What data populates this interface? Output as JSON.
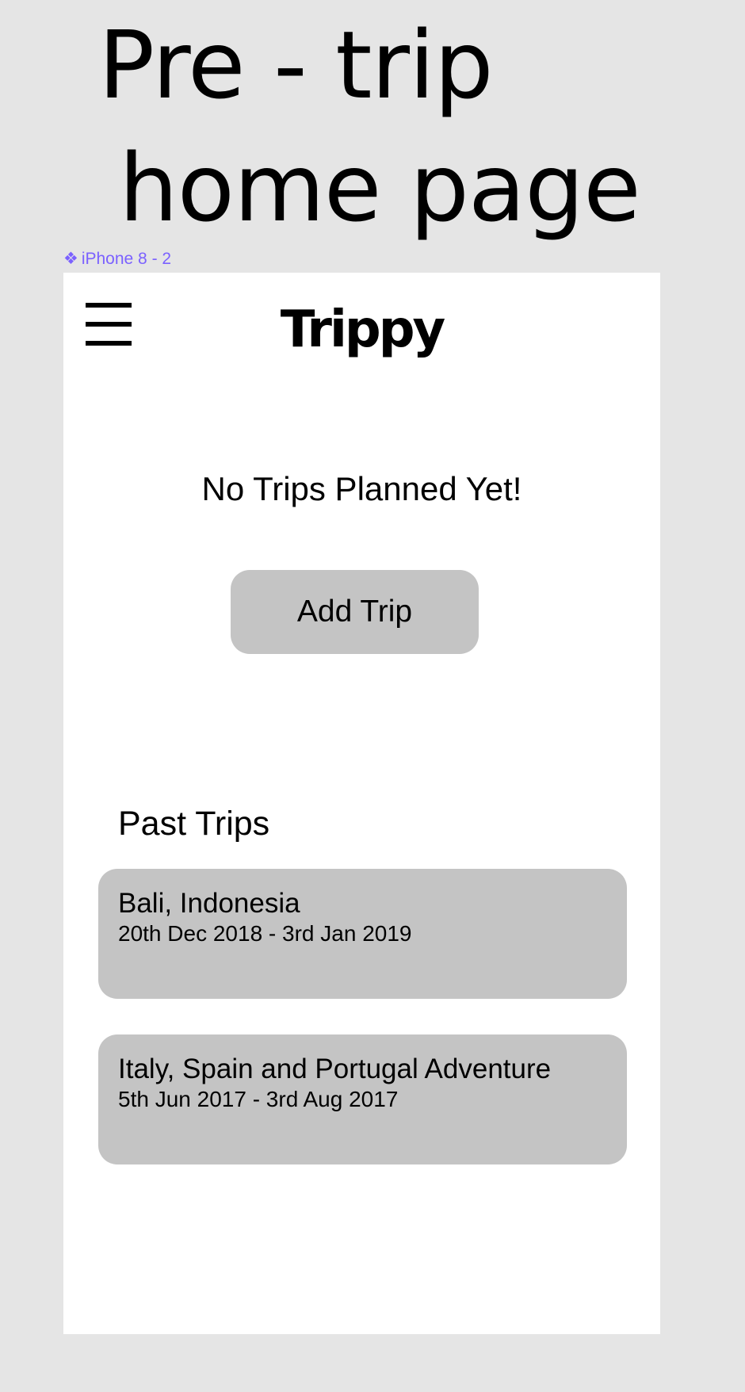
{
  "canvas": {
    "title_line_1": "Pre - trip",
    "title_line_2": "home page",
    "frame_label": "iPhone 8 - 2",
    "frame_label_icon": "component-icon",
    "frame_label_color": "#7b61ff",
    "background_color": "#e5e5e5"
  },
  "app": {
    "logo": "Trippy",
    "menu_icon": "hamburger-menu-icon",
    "empty_state": "No Trips Planned Yet!",
    "add_trip_label": "Add Trip",
    "card_color": "#c4c4c4"
  },
  "past_trips": {
    "heading": "Past Trips",
    "items": [
      {
        "name": "Bali, Indonesia",
        "dates": "20th Dec 2018 - 3rd Jan 2019"
      },
      {
        "name": "Italy, Spain and Portugal Adventure",
        "dates": "5th Jun 2017 - 3rd Aug 2017"
      }
    ]
  }
}
